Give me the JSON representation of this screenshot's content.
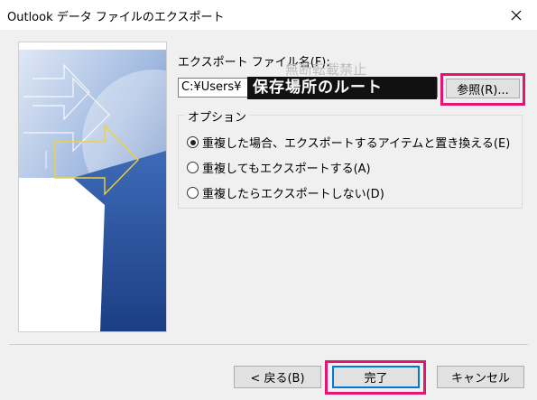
{
  "window": {
    "title": "Outlook データ ファイルのエクスポート"
  },
  "export": {
    "filename_label": "エクスポート ファイル名(F):",
    "filename_value": "C:¥Users¥",
    "overlay_text": "保存場所のルート",
    "watermark": "無断転載禁止",
    "browse_label": "参照(R)..."
  },
  "options": {
    "title": "オプション",
    "items": [
      {
        "label": "重複した場合、エクスポートするアイテムと置き換える(E)",
        "selected": true
      },
      {
        "label": "重複してもエクスポートする(A)",
        "selected": false
      },
      {
        "label": "重複したらエクスポートしない(D)",
        "selected": false
      }
    ]
  },
  "buttons": {
    "back": "< 戻る(B)",
    "finish": "完了",
    "cancel": "キャンセル"
  },
  "colors": {
    "highlight": "#e2166f",
    "art_blue": "#2f5ea8",
    "art_yellow": "#f2d230"
  }
}
